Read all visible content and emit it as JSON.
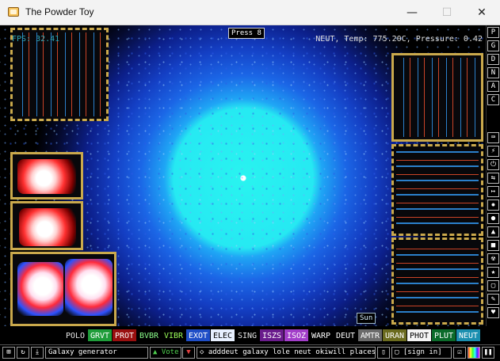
{
  "window": {
    "title": "The Powder Toy",
    "minimize_label": "—",
    "maximize_label": "☐",
    "close_label": "✕",
    "icon": "powder-toy-app-icon"
  },
  "hud": {
    "fps": "FPS: 32.41",
    "press_hint": "Press 8",
    "readout": "NEUT, Temp: 775.20C, Pressure: 0.42",
    "sun_label": "Sun"
  },
  "sidebar": {
    "letters": [
      "P",
      "G",
      "D",
      "N",
      "A",
      "C"
    ],
    "icons": [
      "keyboard-icon",
      "electronics-icon",
      "power-icon",
      "sensor-icon",
      "force-icon",
      "explosives-icon",
      "liquids-icon",
      "powders-icon",
      "solids-icon",
      "radioactive-icon",
      "special-icon",
      "life-icon",
      "tools-icon",
      "favorites-icon"
    ]
  },
  "elements": [
    {
      "label": "POLO",
      "bg": "#000000",
      "fg": "#e6e6e6"
    },
    {
      "label": "GRVT",
      "bg": "#1f9d3a",
      "fg": "#ffffff"
    },
    {
      "label": "PROT",
      "bg": "#9a0f0f",
      "fg": "#ffffff"
    },
    {
      "label": "BVBR",
      "bg": "#000000",
      "fg": "#8cff8c"
    },
    {
      "label": "VIBR",
      "bg": "#000000",
      "fg": "#9cff5a"
    },
    {
      "label": "EXOT",
      "bg": "#1f4ec7",
      "fg": "#ffffff"
    },
    {
      "label": "ELEC",
      "bg": "#e8f0ff",
      "fg": "#000000"
    },
    {
      "label": "SING",
      "bg": "#000000",
      "fg": "#e6e6e6"
    },
    {
      "label": "ISZS",
      "bg": "#6a1c8c",
      "fg": "#ffffff"
    },
    {
      "label": "ISOZ",
      "bg": "#a23ec9",
      "fg": "#ffffff"
    },
    {
      "label": "WARP",
      "bg": "#000000",
      "fg": "#ffffff"
    },
    {
      "label": "DEUT",
      "bg": "#000000",
      "fg": "#ffffff"
    },
    {
      "label": "AMTR",
      "bg": "#6b6b6b",
      "fg": "#ffffff"
    },
    {
      "label": "URAN",
      "bg": "#6b6b1e",
      "fg": "#ffffff"
    },
    {
      "label": "PHOT",
      "bg": "#f5f5f5",
      "fg": "#000000"
    },
    {
      "label": "PLUT",
      "bg": "#0b6b2a",
      "fg": "#ffffff"
    },
    {
      "label": "NEUT",
      "bg": "#1b8fb0",
      "fg": "#ffffff"
    }
  ],
  "bottom": {
    "save_name": "Galaxy generator",
    "vote_label": "Vote",
    "tags_text": "adddeut galaxy lole neut okiwill placeso...",
    "signin_label": "[sign in]"
  },
  "colors": {
    "wall": "#caa94c",
    "sun_core": "#29f3f0"
  }
}
